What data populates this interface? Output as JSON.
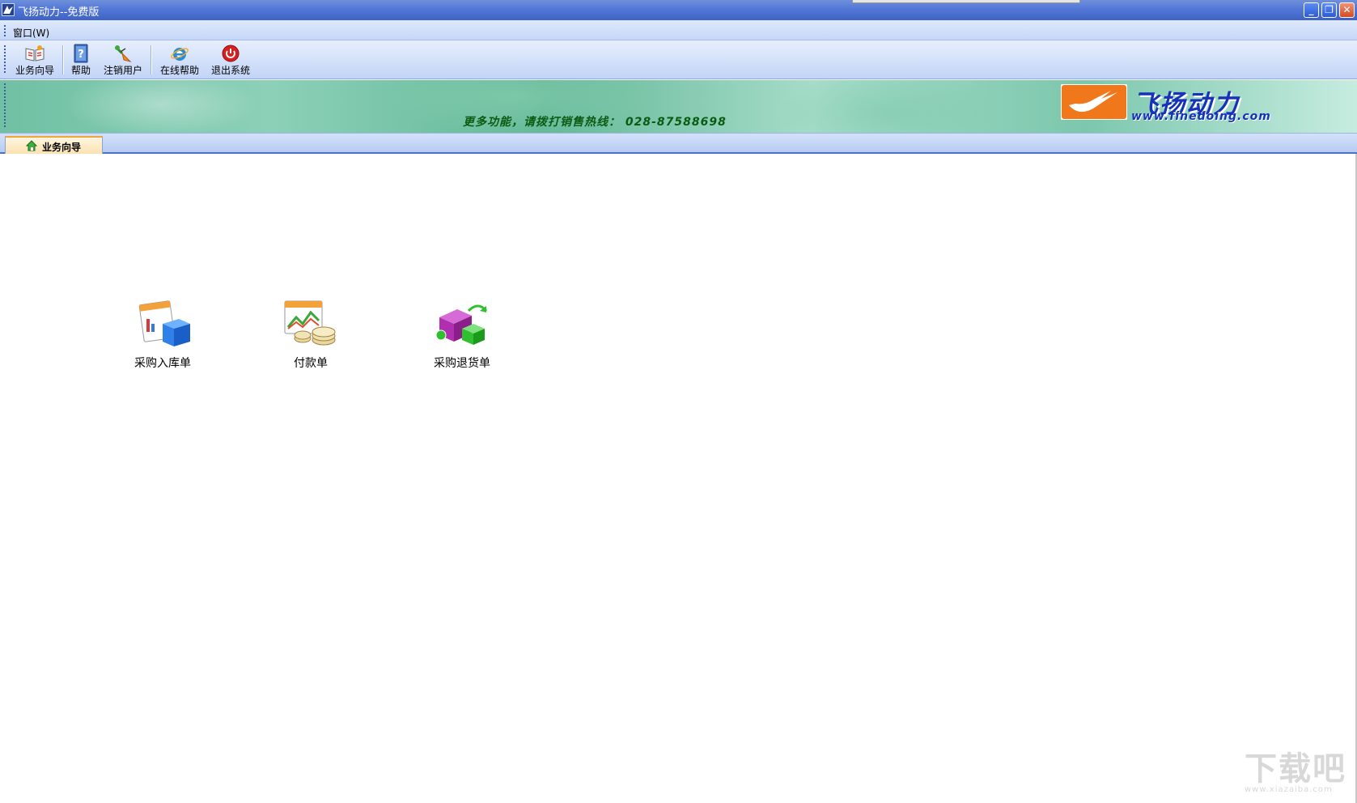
{
  "window": {
    "title": "飞扬动力--免费版",
    "minimize_glyph": "_",
    "restore_glyph": "❐",
    "close_glyph": "✕"
  },
  "menu": {
    "items": [
      {
        "label": "窗口(W)"
      }
    ]
  },
  "toolbar": {
    "buttons": [
      {
        "label": "业务向导",
        "icon": "book-guide-icon"
      },
      {
        "label": "帮助",
        "icon": "help-book-icon"
      },
      {
        "label": "注销用户",
        "icon": "logout-user-icon"
      },
      {
        "label": "在线帮助",
        "icon": "internet-explorer-icon"
      },
      {
        "label": "退出系统",
        "icon": "power-exit-icon"
      }
    ]
  },
  "banner": {
    "slogan": "更多功能，请拨打销售热线： 028-87588698",
    "brand": "飞扬动力",
    "url": "www.finedoing.com"
  },
  "tabs": [
    {
      "label": "业务向导",
      "active": true
    }
  ],
  "shortcuts": [
    {
      "label": "采购入库单",
      "icon": "purchase-inbound-icon"
    },
    {
      "label": "付款单",
      "icon": "payment-coins-icon"
    },
    {
      "label": "采购退货单",
      "icon": "purchase-return-icon"
    }
  ],
  "watermark": {
    "text": "下载吧",
    "url": "www.xiazaiba.com"
  },
  "colors": {
    "titlebar": "#4a6fcf",
    "toolbar": "#d3e0f8",
    "banner_text": "#0b5c12",
    "brand": "#1633b8",
    "tab_accent": "#f2a53a"
  }
}
